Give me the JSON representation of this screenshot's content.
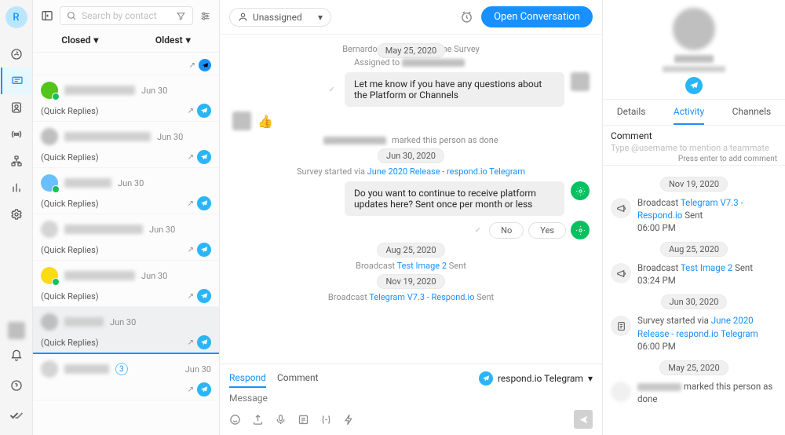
{
  "rail": {
    "avatar_letter": "R"
  },
  "list": {
    "search_placeholder": "Search by contact",
    "sort_status": "Closed",
    "sort_order": "Oldest",
    "items": [
      {
        "date": "Jun 30",
        "quick": "(Quick Replies)",
        "avatar": "green"
      },
      {
        "date": "Jun 30",
        "quick": "(Quick Replies)",
        "avatar": "plain"
      },
      {
        "date": "Jun 30",
        "quick": "(Quick Replies)",
        "avatar": "blue"
      },
      {
        "date": "Jun 30",
        "quick": "(Quick Replies)",
        "avatar": "plain2"
      },
      {
        "date": "Jun 30",
        "quick": "(Quick Replies)",
        "avatar": "yellow"
      },
      {
        "date": "Jun 30",
        "quick": "(Quick Replies)",
        "avatar": "plain",
        "highlighted": true
      },
      {
        "date": "Jun 30",
        "quick": "",
        "avatar": "plain",
        "badge": "3"
      }
    ]
  },
  "center": {
    "assignee": "Unassigned",
    "open_btn": "Open Conversation",
    "events": {
      "survey_started_header": "Bernardo G                      d the Survey",
      "date1_chip": "May 25, 2020",
      "assigned_to": "Assigned to",
      "msg1": "Let me know if you have any questions about the Platform or Channels",
      "done_suffix": " marked this person as done",
      "date2_chip": "Jun 30, 2020",
      "survey_via_prefix": "Survey started via ",
      "survey_via_link": "June 2020 Release - respond.io Telegram",
      "msg2": "Do you want to continue to receive platform updates here? Sent once per month or less",
      "qr_no": "No",
      "qr_yes": "Yes",
      "date3_chip": "Aug 25, 2020",
      "bc1_prefix": "Broadcast ",
      "bc1_link": "Test Image 2",
      "bc1_suffix": " Sent",
      "date4_chip": "Nov 19, 2020",
      "bc2_prefix": "Broadcast ",
      "bc2_link": "Telegram V7.3 - Respond.io",
      "bc2_suffix": " Sent"
    },
    "footer": {
      "tab_respond": "Respond",
      "tab_comment": "Comment",
      "channel_name": "respond.io Telegram",
      "msg_placeholder": "Message "
    }
  },
  "right": {
    "tabs": {
      "details": "Details",
      "activity": "Activity",
      "channels": "Channels"
    },
    "comment": {
      "label": "Comment",
      "placeholder": "Type @username to mention a teammate",
      "hint": "Press enter to add comment"
    },
    "feed": {
      "d1": "Nov 19, 2020",
      "bc1_prefix": "Broadcast ",
      "bc1_link": "Telegram V7.3 - Respond.io",
      "bc1_suffix": " Sent",
      "bc1_time": "06:00 PM",
      "d2": "Aug 25, 2020",
      "bc2_prefix": "Broadcast ",
      "bc2_link": "Test Image 2",
      "bc2_suffix": " Sent",
      "bc2_time": "03:24 PM",
      "d3": "Jun 30, 2020",
      "survey_prefix": "Survey started via ",
      "survey_link": "June 2020 Release - respond.io Telegram",
      "survey_time": "06:00 PM",
      "d4": "May 25, 2020",
      "done_suffix": " marked this person as done"
    }
  }
}
